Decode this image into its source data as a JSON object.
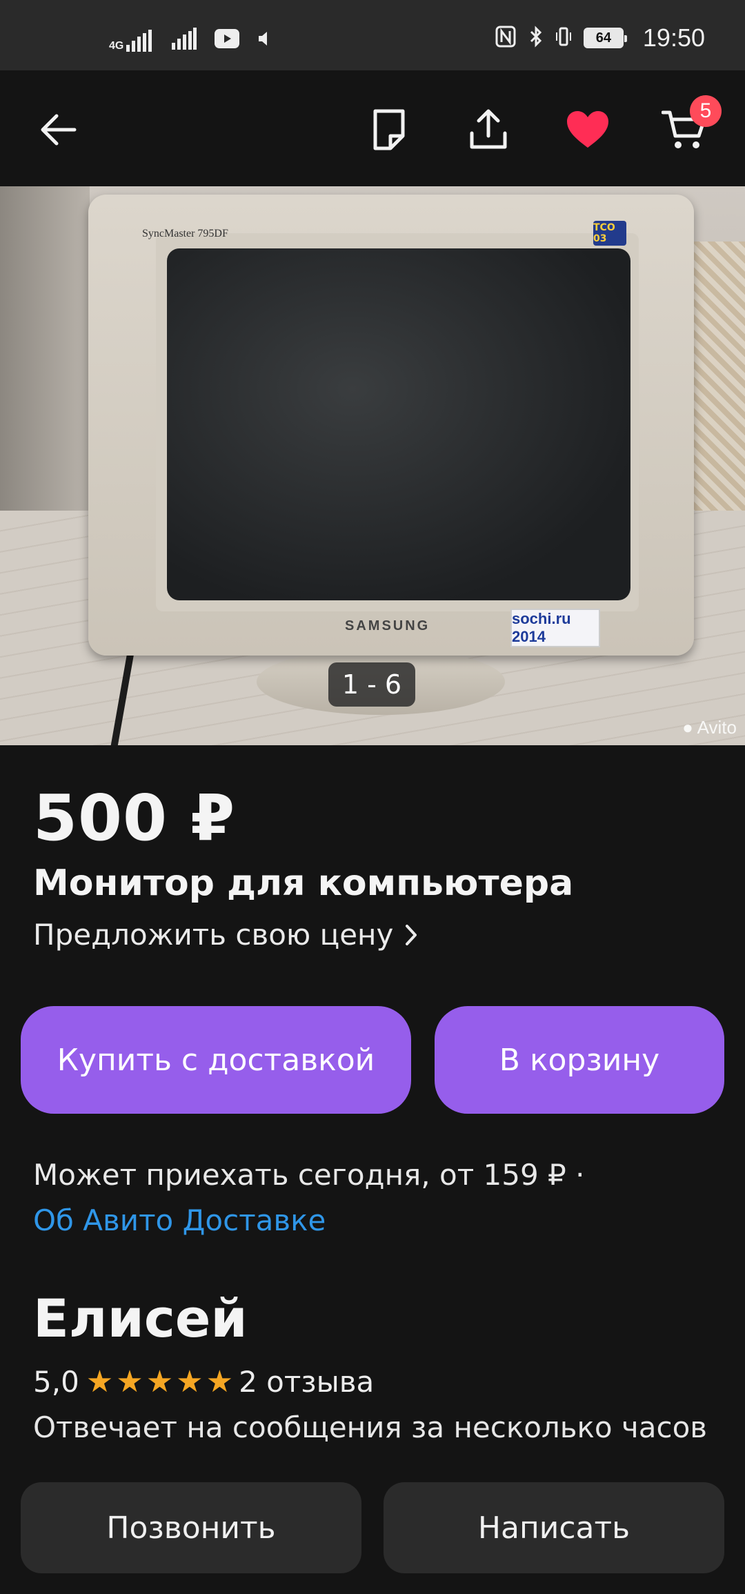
{
  "status_bar": {
    "network_label": "4G",
    "time": "19:50",
    "battery": "64"
  },
  "app_bar": {
    "cart_count": "5",
    "icons": [
      "back-arrow-icon",
      "note-icon",
      "share-icon",
      "heart-icon",
      "cart-icon"
    ],
    "favorite_color": "#ff2d55"
  },
  "photo": {
    "counter": "1 - 6",
    "watermark": "Avito",
    "model_text": "SyncMaster 795DF",
    "brand_text": "SAMSUNG",
    "sticker_text": "sochi.ru 2014",
    "tco_label": "TCO 03"
  },
  "listing": {
    "price": "500 ₽",
    "title": "Монитор для компьютера",
    "offer_label": "Предложить свою цену"
  },
  "actions": {
    "buy_label": "Купить с доставкой",
    "cart_label": "В корзину",
    "accent": "#965eeb"
  },
  "delivery": {
    "text": "Может приехать сегодня, от 159 ₽ ·",
    "link": "Об Авито Доставке",
    "link_color": "#2f96e8"
  },
  "seller": {
    "name": "Елисей",
    "rating": "5,0",
    "stars_filled": 5,
    "reviews": "2 отзыва",
    "response_time": "Отвечает на сообщения за несколько часов"
  },
  "contact": {
    "call_label": "Позвонить",
    "message_label": "Написать"
  }
}
